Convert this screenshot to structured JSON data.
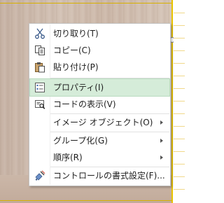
{
  "menu": {
    "items": [
      {
        "label": "切り取り(T)",
        "icon": "scissors-icon"
      },
      {
        "label": "コピー(C)",
        "icon": "copy-icon"
      },
      {
        "label": "貼り付け(P)",
        "icon": "paste-icon"
      },
      {
        "label": "プロパティ(I)",
        "icon": "properties-icon",
        "highlighted": true
      },
      {
        "label": "コードの表示(V)",
        "icon": "view-code-icon"
      },
      {
        "label": "イメージ オブジェクト(O)",
        "submenu": true
      },
      {
        "label": "グループ化(G)",
        "submenu": true
      },
      {
        "label": "順序(R)",
        "submenu": true
      },
      {
        "label": "コントロールの書式設定(F)...",
        "icon": "format-control-icon"
      }
    ]
  },
  "colors": {
    "highlight": "#d5ecd9",
    "selection_frame": "#e8c300"
  }
}
